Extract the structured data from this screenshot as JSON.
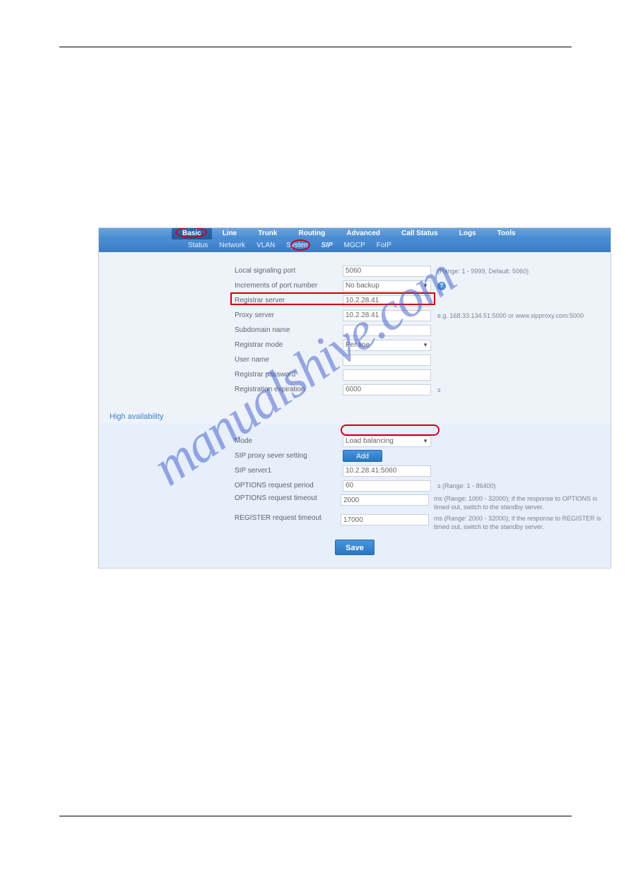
{
  "main_nav": {
    "tabs": [
      "Basic",
      "Line",
      "Trunk",
      "Routing",
      "Advanced",
      "Call Status",
      "Logs",
      "Tools"
    ],
    "active": "Basic"
  },
  "sub_nav": {
    "items": [
      "Status",
      "Network",
      "VLAN",
      "System",
      "SIP",
      "MGCP",
      "FoIP"
    ],
    "active": "SIP"
  },
  "basic_form": {
    "local_signaling_port": {
      "label": "Local signaling port",
      "value": "5060",
      "hint": "(Range: 1 - 9999, Default: 5060)"
    },
    "increments": {
      "label": "Increments of port number",
      "value": "No backup"
    },
    "registrar_server": {
      "label": "Registrar server",
      "value": "10.2.28.41"
    },
    "proxy_server": {
      "label": "Proxy server",
      "value": "10.2.28.41",
      "hint": "e.g. 168.33.134.51:5000 or www.sipproxy.com:5000"
    },
    "subdomain": {
      "label": "Subdomain name",
      "value": ""
    },
    "registrar_mode": {
      "label": "Registrar mode",
      "value": "Per line"
    },
    "user_name": {
      "label": "User name",
      "value": ""
    },
    "registrar_password": {
      "label": "Registrar password",
      "value": ""
    },
    "reg_expiration": {
      "label": "Registration expiration",
      "value": "6000",
      "unit": "s"
    }
  },
  "ha_title": "High availability",
  "ha_form": {
    "mode": {
      "label": "Mode",
      "value": "Load balancing"
    },
    "sip_proxy_setting": {
      "label": "SIP proxy sever setting",
      "btn": "Add"
    },
    "sip_server1": {
      "label": "SIP server1",
      "value": "10.2.28.41:5060"
    },
    "options_period": {
      "label": "OPTIONS request period",
      "value": "60",
      "hint": "s (Range: 1 - 86400)"
    },
    "options_timeout": {
      "label": "OPTIONS request timeout",
      "value": "2000",
      "hint": "ms (Range: 1000 - 32000); if the response to OPTIONS is timed out, switch to the standby server."
    },
    "register_timeout": {
      "label": "REGISTER request timeout",
      "value": "17000",
      "hint": "ms (Range: 2000 - 32000); if the response to REGISTER is timed out, switch to the standby server."
    }
  },
  "save_label": "Save",
  "watermark": "manualshive.com"
}
